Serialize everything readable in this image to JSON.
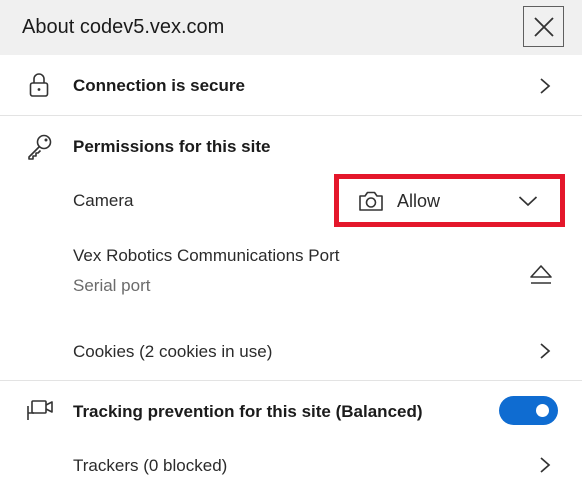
{
  "header": {
    "title": "About codev5.vex.com"
  },
  "connection": {
    "label": "Connection is secure"
  },
  "permissions": {
    "heading": "Permissions for this site",
    "camera": {
      "label": "Camera",
      "selected": "Allow"
    },
    "serial": {
      "device": "Vex Robotics Communications Port",
      "type": "Serial port"
    },
    "cookies": {
      "label": "Cookies (2 cookies in use)"
    }
  },
  "tracking": {
    "label": "Tracking prevention for this site (Balanced)",
    "enabled": true,
    "trackers": {
      "label": "Trackers (0 blocked)"
    }
  },
  "colors": {
    "highlight": "#e4172b",
    "toggle_on": "#0f6cd1",
    "header_bg": "#f0f0f0"
  }
}
